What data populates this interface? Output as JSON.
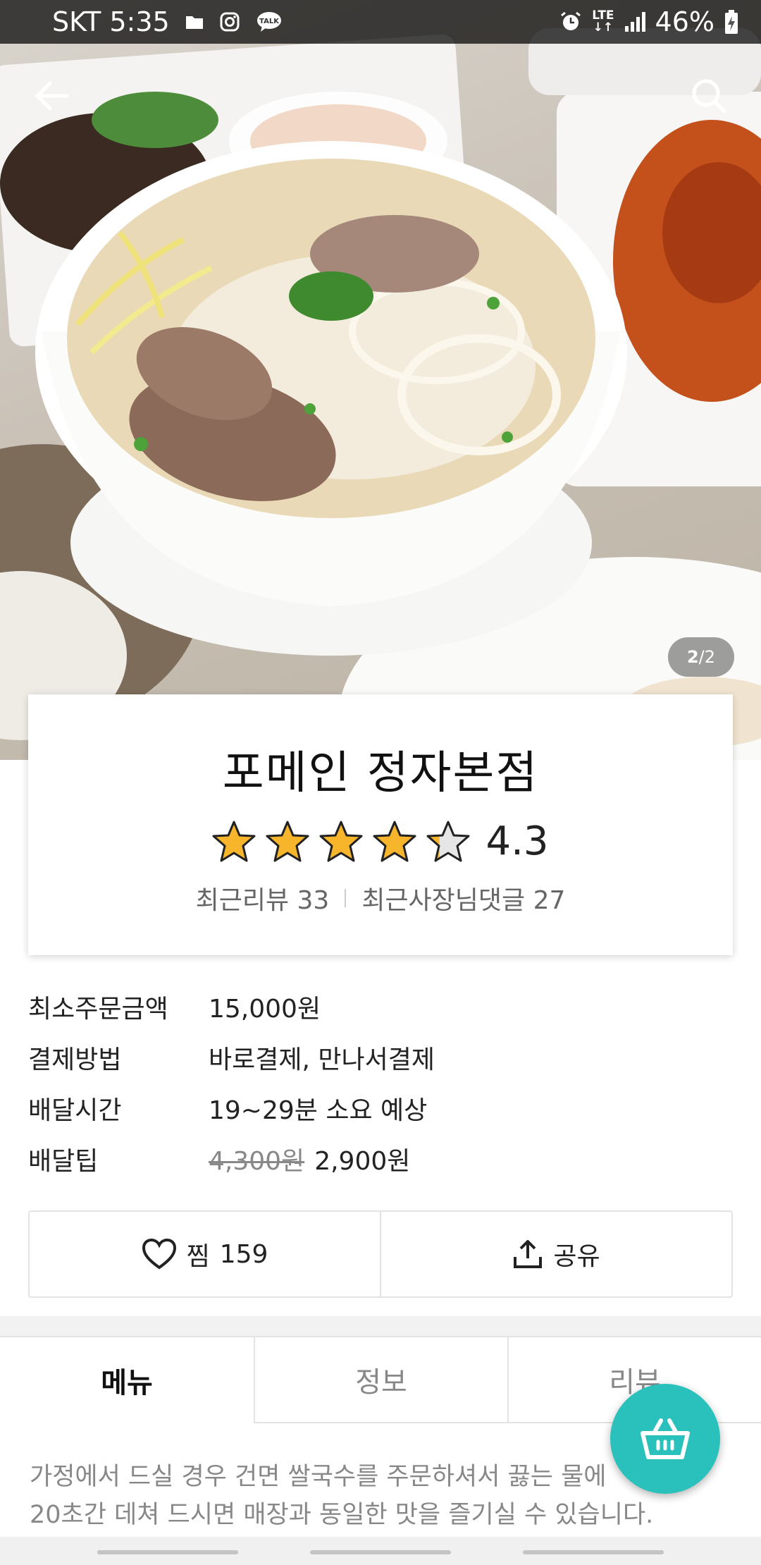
{
  "status_bar": {
    "carrier_time": "SKT 5:35",
    "talk_label": "TALK",
    "network": "LTE",
    "battery": "46%"
  },
  "hero": {
    "pager_current": "2",
    "pager_total": "/2"
  },
  "restaurant": {
    "name": "포메인 정자본점",
    "rating": "4.3",
    "rating_value": 4.3,
    "recent_reviews": "최근리뷰 33",
    "owner_replies": "최근사장님댓글 27"
  },
  "details": [
    {
      "label": "최소주문금액",
      "value": "15,000원"
    },
    {
      "label": "결제방법",
      "value": "바로결제, 만나서결제"
    },
    {
      "label": "배달시간",
      "value": "19~29분 소요 예상"
    },
    {
      "label": "배달팁",
      "old_value": "4,300원",
      "value": "2,900원"
    }
  ],
  "actions": {
    "like_label": "찜",
    "like_count": "159",
    "share_label": "공유"
  },
  "tabs": [
    "메뉴",
    "정보",
    "리뷰"
  ],
  "description": {
    "line1": "가정에서 드실 경우 건면 쌀국수를 주문하셔서 끓는 물에",
    "line2": "20초간 데쳐 드시면 매장과 동일한 맛을 즐기실 수 있습니다."
  },
  "colors": {
    "accent": "#2ac1bc",
    "star": "#f7b52c"
  },
  "icons": [
    "back-arrow-icon",
    "search-icon",
    "heart-icon",
    "share-icon",
    "cart-basket-icon"
  ]
}
